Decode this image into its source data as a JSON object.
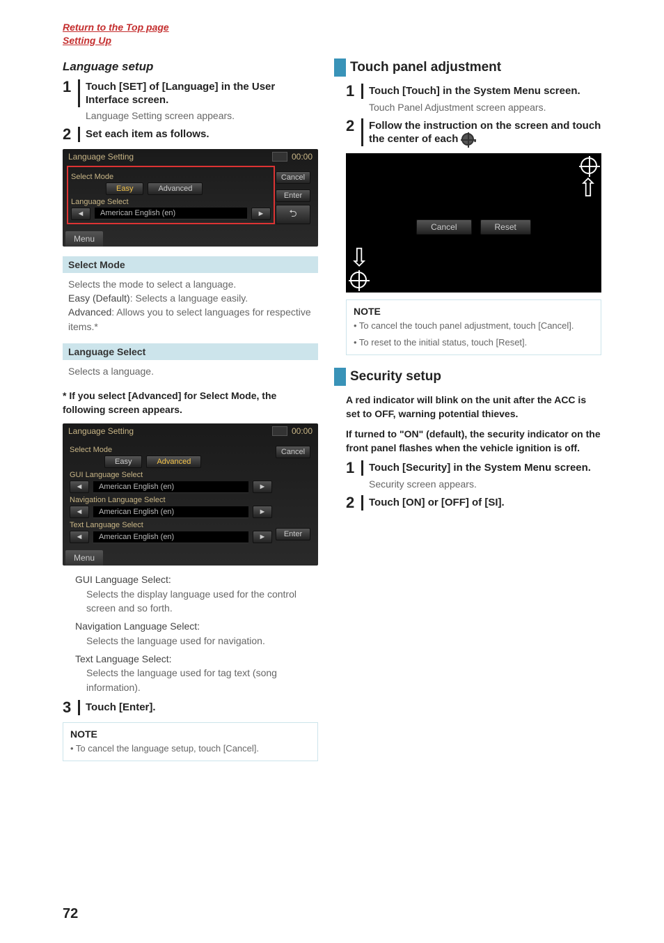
{
  "top_links": {
    "return": "Return to the Top page",
    "section": "Setting Up"
  },
  "left": {
    "section_title": "Language setup",
    "step1": {
      "instr": "Touch [SET] of [Language] in the User Interface screen.",
      "sub": "Language Setting screen appears."
    },
    "step2": {
      "instr": "Set each item as follows."
    },
    "ui1": {
      "title": "Language Setting",
      "clock": "00:00",
      "select_mode_label": "Select Mode",
      "easy": "Easy",
      "advanced": "Advanced",
      "lang_select_label": "Language Select",
      "lang_value": "American English (en)",
      "cancel": "Cancel",
      "enter": "Enter",
      "menu": "Menu"
    },
    "shade1_title": "Select Mode",
    "shade1_body": "Selects the mode to select a language.",
    "shade1_easy_t": "Easy (Default)",
    "shade1_easy_b": ": Selects a language easily.",
    "shade1_adv_t": "Advanced",
    "shade1_adv_b": ": Allows you to select languages for respective items.*",
    "shade2_title": "Language Select",
    "shade2_body": "Selects a language.",
    "advnote": "* If you select [Advanced] for Select Mode, the following screen appears.",
    "ui2": {
      "title": "Language Setting",
      "clock": "00:00",
      "select_mode_label": "Select Mode",
      "easy": "Easy",
      "advanced": "Advanced",
      "gui_label": "GUI Language Select",
      "nav_label": "Navigation Language Select",
      "text_label": "Text Language Select",
      "val": "American English (en)",
      "cancel": "Cancel",
      "enter": "Enter",
      "menu": "Menu"
    },
    "defs": {
      "gui_t": "GUI Language Select",
      "gui_b": "Selects the display language used for the control screen and so forth.",
      "nav_t": "Navigation Language Select",
      "nav_b": "Selects the language used for navigation.",
      "text_t": "Text Language Select",
      "text_b": "Selects the language used for tag text (song information)."
    },
    "step3": {
      "instr": "Touch [Enter]."
    },
    "note_title": "NOTE",
    "note_line": "• To cancel the language setup, touch [Cancel]."
  },
  "right": {
    "h2_touch": "Touch panel adjustment",
    "step1": {
      "instr": "Touch [Touch] in the System Menu screen.",
      "sub": "Touch Panel Adjustment screen appears."
    },
    "step2_a": "Follow the instruction on the screen and touch the center of each ",
    "step2_b": ".",
    "touch_ui": {
      "cancel": "Cancel",
      "reset": "Reset"
    },
    "note_title": "NOTE",
    "note1": "• To cancel the touch panel adjustment, touch [Cancel].",
    "note2": "• To reset to the initial status, touch [Reset].",
    "h2_sec": "Security setup",
    "sec_p1": "A red indicator will blink on the unit after the ACC is set to OFF, warning potential thieves.",
    "sec_p2": "If turned to \"ON\" (default), the security indicator on the front panel flashes when the vehicle ignition is off.",
    "sec_step1": {
      "instr": "Touch [Security] in the System Menu screen.",
      "sub": "Security screen appears."
    },
    "sec_step2": {
      "instr": "Touch [ON] or [OFF] of [SI]."
    }
  },
  "page_number": "72"
}
